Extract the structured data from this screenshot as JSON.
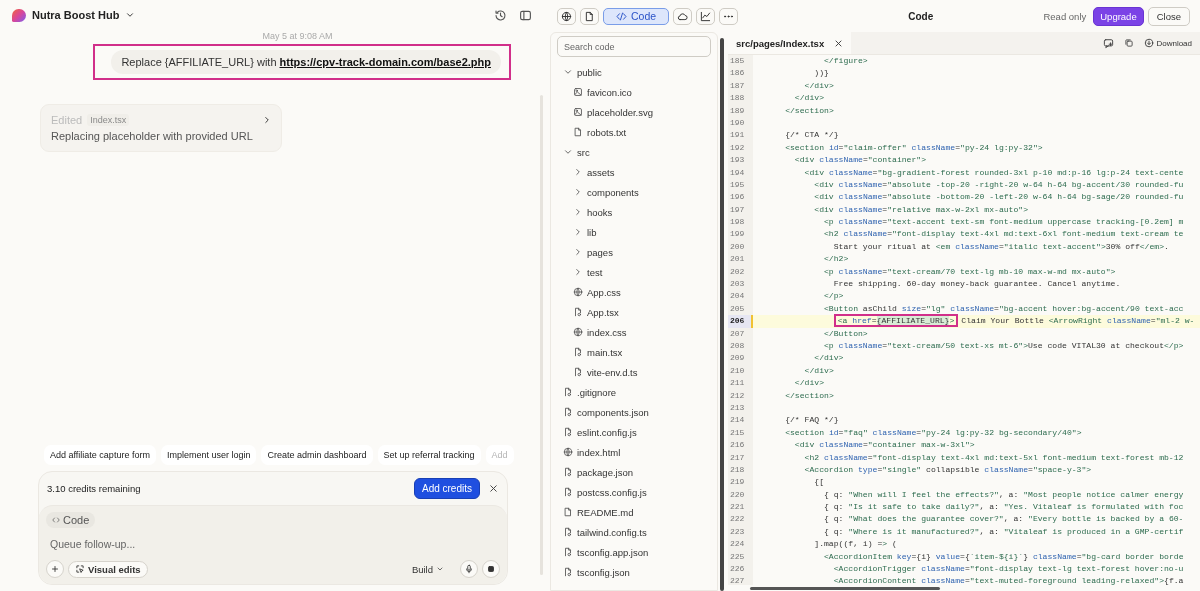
{
  "project": {
    "name": "Nutra Boost Hub"
  },
  "chat": {
    "timestamp": "May 5 at 9:08 AM",
    "message": {
      "text": "Replace {AFFILIATE_URL} with",
      "link": "https://cpv-track-domain.com/base2.php",
      "annotated": true
    },
    "edit_card": {
      "status": "Edited",
      "file": "Index.tsx",
      "summary": "Replacing placeholder with provided URL"
    },
    "suggestions": [
      {
        "label": "Add affiliate capture form",
        "faded": false
      },
      {
        "label": "Implement user login",
        "faded": false
      },
      {
        "label": "Create admin dashboard",
        "faded": false
      },
      {
        "label": "Set up referral tracking",
        "faded": false
      },
      {
        "label": "Add",
        "faded": true
      }
    ],
    "credits": {
      "text": "3.10 credits remaining",
      "button": "Add credits"
    },
    "composer": {
      "mode_chip": "Code",
      "placeholder": "Queue follow-up...",
      "visual_edits": "Visual edits",
      "build": "Build"
    }
  },
  "toolbar": {
    "views": [
      {
        "kind": "globe",
        "selected": false
      },
      {
        "kind": "file",
        "selected": false
      },
      {
        "kind": "code",
        "label": "Code",
        "selected": true
      },
      {
        "kind": "cloud",
        "selected": false
      },
      {
        "kind": "chart",
        "selected": false
      },
      {
        "kind": "more",
        "selected": false
      }
    ],
    "title": "Code",
    "read_only": "Read only",
    "upgrade": "Upgrade",
    "close": "Close"
  },
  "file_tree": {
    "search_placeholder": "Search code",
    "items": [
      {
        "name": "public",
        "kind": "folder",
        "expanded": true,
        "children": [
          {
            "name": "favicon.ico",
            "kind": "image"
          },
          {
            "name": "placeholder.svg",
            "kind": "image"
          },
          {
            "name": "robots.txt",
            "kind": "text"
          }
        ]
      },
      {
        "name": "src",
        "kind": "folder",
        "expanded": true,
        "children": [
          {
            "name": "assets",
            "kind": "folder",
            "expanded": false
          },
          {
            "name": "components",
            "kind": "folder",
            "expanded": false
          },
          {
            "name": "hooks",
            "kind": "folder",
            "expanded": false
          },
          {
            "name": "lib",
            "kind": "folder",
            "expanded": false
          },
          {
            "name": "pages",
            "kind": "folder",
            "expanded": false
          },
          {
            "name": "test",
            "kind": "folder",
            "expanded": false
          },
          {
            "name": "App.css",
            "kind": "web"
          },
          {
            "name": "App.tsx",
            "kind": "code"
          },
          {
            "name": "index.css",
            "kind": "web"
          },
          {
            "name": "main.tsx",
            "kind": "code"
          },
          {
            "name": "vite-env.d.ts",
            "kind": "code"
          }
        ]
      },
      {
        "name": ".gitignore",
        "kind": "code"
      },
      {
        "name": "components.json",
        "kind": "code"
      },
      {
        "name": "eslint.config.js",
        "kind": "code"
      },
      {
        "name": "index.html",
        "kind": "web"
      },
      {
        "name": "package.json",
        "kind": "code"
      },
      {
        "name": "postcss.config.js",
        "kind": "code"
      },
      {
        "name": "README.md",
        "kind": "text"
      },
      {
        "name": "tailwind.config.ts",
        "kind": "code"
      },
      {
        "name": "tsconfig.app.json",
        "kind": "code"
      },
      {
        "name": "tsconfig.json",
        "kind": "code"
      }
    ]
  },
  "editor": {
    "tab": "src/pages/Index.tsx",
    "download": "Download",
    "lines": [
      {
        "n": "185",
        "current": false,
        "text": "              </figure>"
      },
      {
        "n": "186",
        "current": false,
        "text": "            ))}"
      },
      {
        "n": "187",
        "current": false,
        "text": "          </div>"
      },
      {
        "n": "188",
        "current": false,
        "text": "        </div>"
      },
      {
        "n": "189",
        "current": false,
        "text": "      </section>"
      },
      {
        "n": "190",
        "current": false
      },
      {
        "n": "191",
        "current": false,
        "text": "      {/* CTA */}"
      },
      {
        "n": "192",
        "current": false,
        "text": "      <section id=\"claim-offer\" className=\"py-24 lg:py-32\">"
      },
      {
        "n": "193",
        "current": false,
        "text": "        <div className=\"container\">"
      },
      {
        "n": "194",
        "current": false,
        "text": "          <div className=\"bg-gradient-forest rounded-3xl p-10 md:p-16 lg:p-24 text-cente"
      },
      {
        "n": "195",
        "current": false,
        "text": "            <div className=\"absolute -top-20 -right-20 w-64 h-64 bg-accent/30 rounded-fu"
      },
      {
        "n": "196",
        "current": false,
        "text": "            <div className=\"absolute -bottom-20 -left-20 w-64 h-64 bg-sage/20 rounded-fu"
      },
      {
        "n": "197",
        "current": false,
        "text": "            <div className=\"relative max-w-2xl mx-auto\">"
      },
      {
        "n": "198",
        "current": false,
        "text": "              <p className=\"text-accent text-sm font-medium uppercase tracking-[0.2em] m"
      },
      {
        "n": "199",
        "current": false,
        "text": "              <h2 className=\"font-display text-4xl md:text-6xl font-medium text-cream te"
      },
      {
        "n": "200",
        "current": false,
        "text": "                Start your ritual at <em className=\"italic text-accent\">30% off</em>."
      },
      {
        "n": "201",
        "current": false,
        "text": "              </h2>"
      },
      {
        "n": "202",
        "current": false,
        "text": "              <p className=\"text-cream/70 text-lg mb-10 max-w-md mx-auto\">"
      },
      {
        "n": "203",
        "current": false,
        "text": "                Free shipping. 60-day money-back guarantee. Cancel anytime."
      },
      {
        "n": "204",
        "current": false,
        "text": "              </p>"
      },
      {
        "n": "205",
        "current": false,
        "text": "              <Button asChild size=\"lg\" className=\"bg-accent hover:bg-accent/90 text-acc"
      },
      {
        "n": "206",
        "current": true,
        "parts": [
          {
            "text": "                <a href=",
            "annotated": true,
            "match": false
          },
          {
            "text": "{AFFILIATE_URL}",
            "annotated": true,
            "match": true
          },
          {
            "text": ">",
            "annotated": true,
            "match": false
          },
          {
            "text": "Claim Your Bottle <ArrowRight className=\"ml-2 w-",
            "annotated": false,
            "match": false
          }
        ]
      },
      {
        "n": "207",
        "current": false,
        "text": "              </Button>"
      },
      {
        "n": "208",
        "current": false,
        "text": "              <p className=\"text-cream/50 text-xs mt-6\">Use code VITAL30 at checkout</p>"
      },
      {
        "n": "209",
        "current": false,
        "text": "            </div>"
      },
      {
        "n": "210",
        "current": false,
        "text": "          </div>"
      },
      {
        "n": "211",
        "current": false,
        "text": "        </div>"
      },
      {
        "n": "212",
        "current": false,
        "text": "      </section>"
      },
      {
        "n": "213",
        "current": false
      },
      {
        "n": "214",
        "current": false,
        "text": "      {/* FAQ */}"
      },
      {
        "n": "215",
        "current": false,
        "text": "      <section id=\"faq\" className=\"py-24 lg:py-32 bg-secondary/40\">"
      },
      {
        "n": "216",
        "current": false,
        "text": "        <div className=\"container max-w-3xl\">"
      },
      {
        "n": "217",
        "current": false,
        "text": "          <h2 className=\"font-display text-4xl md:text-5xl font-medium text-forest mb-12"
      },
      {
        "n": "218",
        "current": false,
        "text": "          <Accordion type=\"single\" collapsible className=\"space-y-3\">"
      },
      {
        "n": "219",
        "current": false,
        "text": "            {["
      },
      {
        "n": "220",
        "current": false,
        "text": "              { q: \"When will I feel the effects?\", a: \"Most people notice calmer energy"
      },
      {
        "n": "221",
        "current": false,
        "text": "              { q: \"Is it safe to take daily?\", a: \"Yes. Vitaleaf is formulated with foc"
      },
      {
        "n": "222",
        "current": false,
        "text": "              { q: \"What does the guarantee cover?\", a: \"Every bottle is backed by a 60-"
      },
      {
        "n": "223",
        "current": false,
        "text": "              { q: \"Where is it manufactured?\", a: \"Vitaleaf is produced in a GMP-certif"
      },
      {
        "n": "224",
        "current": false,
        "text": "            ].map((f, i) => ("
      },
      {
        "n": "225",
        "current": false,
        "text": "              <AccordionItem key={i} value={`item-${i}`} className=\"bg-card border borde"
      },
      {
        "n": "226",
        "current": false,
        "text": "                <AccordionTrigger className=\"font-display text-lg text-forest hover:no-u"
      },
      {
        "n": "227",
        "current": false,
        "text": "                <AccordionContent className=\"text-muted-foreground leading-relaxed\">{f.a"
      }
    ]
  }
}
